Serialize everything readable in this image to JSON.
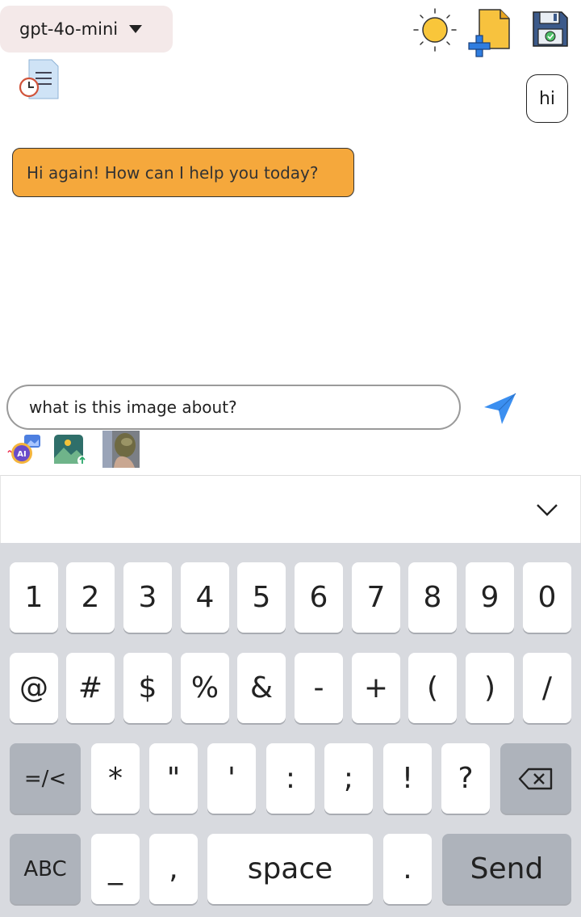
{
  "topbar": {
    "model": "gpt-4o-mini",
    "icons": [
      "sun-icon",
      "new-file-icon",
      "save-disk-icon",
      "history-doc-icon"
    ]
  },
  "chat": {
    "user_message": "hi",
    "assistant_message": "Hi again! How can I help you today?"
  },
  "composer": {
    "input_value": "what is this image about?",
    "send_icon": "send-arrow-icon",
    "attachments": [
      "ai-image-icon",
      "image-upload-icon",
      "attached-image-thumbnail"
    ]
  },
  "keyboard": {
    "collapse_icon": "chevron-down-icon",
    "row1": [
      "1",
      "2",
      "3",
      "4",
      "5",
      "6",
      "7",
      "8",
      "9",
      "0"
    ],
    "row2": [
      "@",
      "#",
      "$",
      "%",
      "&",
      "-",
      "+",
      "(",
      ")",
      "/"
    ],
    "row3": [
      "=/<",
      "*",
      "\"",
      "'",
      ":",
      ";",
      "!",
      "?"
    ],
    "row4": {
      "abc": "ABC",
      "underscore": "_",
      "comma": ",",
      "space": "space",
      "period": ".",
      "send": "Send"
    }
  },
  "colors": {
    "assistant_bubble": "#f5a83c",
    "keyboard_bg": "#d8dadf",
    "send_arrow": "#3b8ff0"
  }
}
